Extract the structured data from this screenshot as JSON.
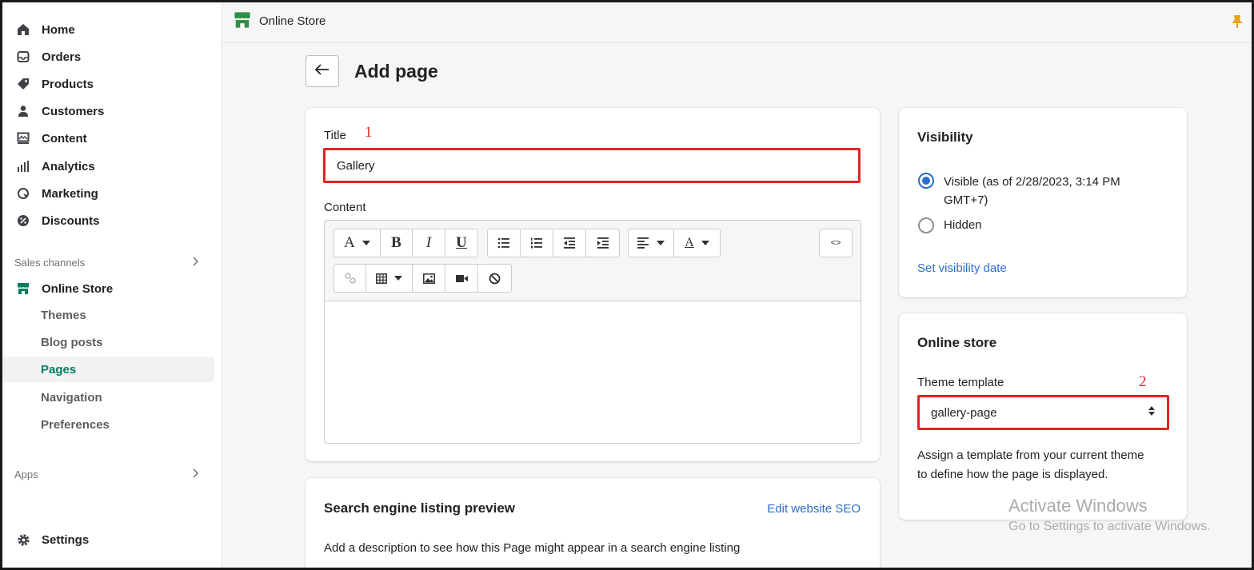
{
  "sidebar": {
    "items": [
      {
        "label": "Home",
        "icon": "home-icon"
      },
      {
        "label": "Orders",
        "icon": "orders-icon"
      },
      {
        "label": "Products",
        "icon": "tag-icon"
      },
      {
        "label": "Customers",
        "icon": "person-icon"
      },
      {
        "label": "Content",
        "icon": "content-icon"
      },
      {
        "label": "Analytics",
        "icon": "bar-chart-icon"
      },
      {
        "label": "Marketing",
        "icon": "marketing-icon"
      },
      {
        "label": "Discounts",
        "icon": "discount-icon"
      }
    ],
    "sales_channels_label": "Sales channels",
    "online_store_label": "Online Store",
    "sub_items": [
      "Themes",
      "Blog posts",
      "Pages",
      "Navigation",
      "Preferences"
    ],
    "active_sub_item": "Pages",
    "apps_label": "Apps",
    "settings_label": "Settings"
  },
  "topbar": {
    "store_label": "Online Store"
  },
  "page": {
    "title": "Add page"
  },
  "main_card": {
    "title_label": "Title",
    "title_value": "Gallery",
    "content_label": "Content",
    "annotation_1": "1"
  },
  "toolbar": {
    "font_btn": "A",
    "bold_btn": "B",
    "italic_btn": "I",
    "underline_btn": "U",
    "color_btn": "A",
    "html_btn": "<>"
  },
  "seo_card": {
    "title": "Search engine listing preview",
    "edit_link": "Edit website SEO",
    "description": "Add a description to see how this Page might appear in a search engine listing"
  },
  "visibility_card": {
    "title": "Visibility",
    "visible_label": "Visible (as of 2/28/2023, 3:14 PM GMT+7)",
    "hidden_label": "Hidden",
    "selected": "Visible",
    "set_date_link": "Set visibility date"
  },
  "online_store_card": {
    "title": "Online store",
    "template_label": "Theme template",
    "template_value": "gallery-page",
    "help_text": "Assign a template from your current theme to define how the page is displayed.",
    "annotation_2": "2"
  },
  "watermark": {
    "line1": "Activate Windows",
    "line2": "Go to Settings to activate Windows."
  },
  "colors": {
    "accent_green": "#007f5f",
    "link_blue": "#2c6ecb",
    "annotation_red": "#e02424",
    "pin_orange": "#e8a317"
  }
}
